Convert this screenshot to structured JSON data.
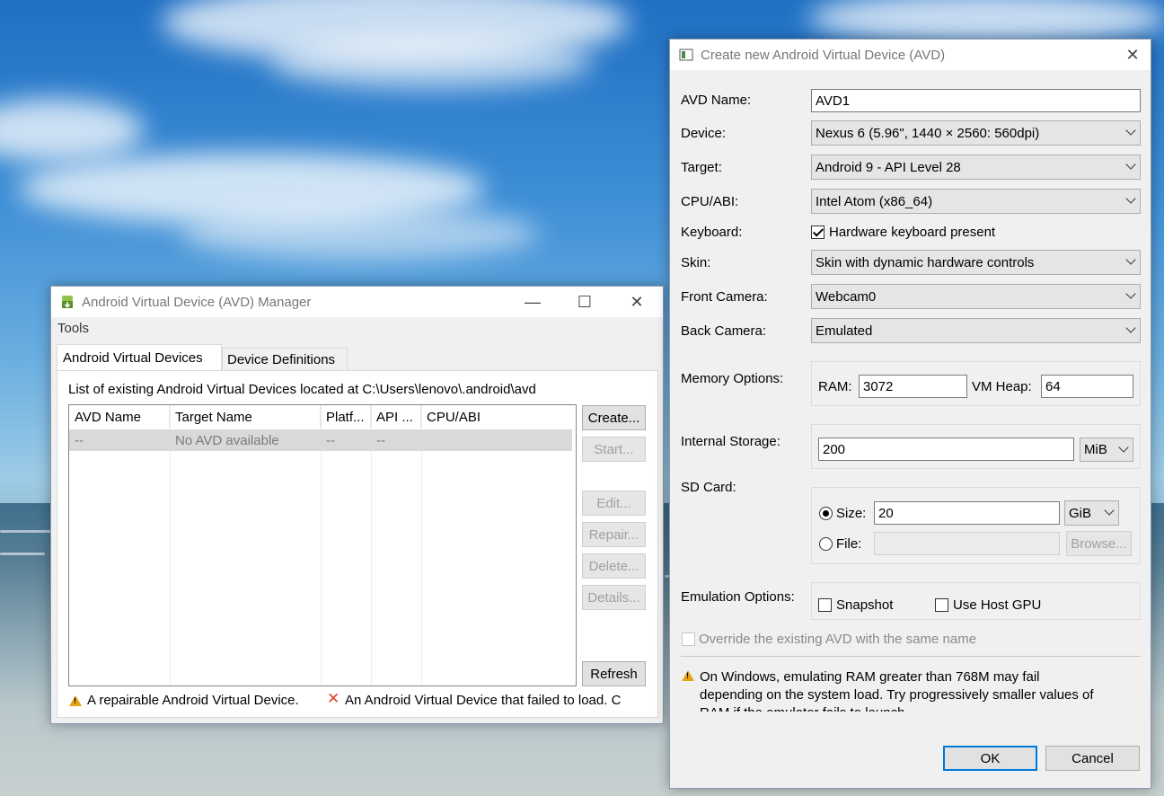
{
  "avd_manager": {
    "title": "Android Virtual Device (AVD) Manager",
    "menu": "Tools",
    "tabs": [
      "Android Virtual Devices",
      "Device Definitions"
    ],
    "location_text": "List of existing Android Virtual Devices located at C:\\Users\\lenovo\\.android\\avd",
    "columns": [
      "AVD Name",
      "Target Name",
      "Platf...",
      "API ...",
      "CPU/ABI"
    ],
    "row": [
      "--",
      "No AVD available",
      "--",
      "--",
      ""
    ],
    "buttons": {
      "create": "Create...",
      "start": "Start...",
      "edit": "Edit...",
      "repair": "Repair...",
      "delete": "Delete...",
      "details": "Details...",
      "refresh": "Refresh"
    },
    "legend_repairable": "A repairable Android Virtual Device.",
    "legend_failed": "An Android Virtual Device that failed to load. C"
  },
  "create_avd": {
    "title": "Create new Android Virtual Device (AVD)",
    "labels": {
      "avd_name": "AVD Name:",
      "device": "Device:",
      "target": "Target:",
      "cpu_abi": "CPU/ABI:",
      "keyboard": "Keyboard:",
      "skin": "Skin:",
      "front_camera": "Front Camera:",
      "back_camera": "Back Camera:",
      "memory_options": "Memory Options:",
      "ram": "RAM:",
      "vm_heap": "VM Heap:",
      "internal_storage": "Internal Storage:",
      "sd_card": "SD Card:",
      "size": "Size:",
      "file": "File:",
      "emulation_options": "Emulation Options:"
    },
    "values": {
      "avd_name": "AVD1",
      "device": "Nexus 6 (5.96\", 1440 × 2560: 560dpi)",
      "target": "Android 9 - API Level 28",
      "cpu_abi": "Intel Atom (x86_64)",
      "keyboard_label": "Hardware keyboard present",
      "skin": "Skin with dynamic hardware controls",
      "front_camera": "Webcam0",
      "back_camera": "Emulated",
      "ram": "3072",
      "vm_heap": "64",
      "internal_storage": "200",
      "internal_storage_unit": "MiB",
      "sd_size": "20",
      "sd_unit": "GiB",
      "sd_file": ""
    },
    "checkboxes": {
      "hardware_keyboard": true,
      "snapshot": false,
      "use_host_gpu": false,
      "override": false
    },
    "snapshot_label": "Snapshot",
    "host_gpu_label": "Use Host GPU",
    "browse_label": "Browse...",
    "override_label": "Override the existing AVD with the same name",
    "warning_line1": "On Windows, emulating RAM greater than 768M may fail",
    "warning_line2": "depending on the system load. Try progressively smaller values of",
    "warning_line3": "RAM if the emulator fails to launch.",
    "ok_label": "OK",
    "cancel_label": "Cancel"
  }
}
